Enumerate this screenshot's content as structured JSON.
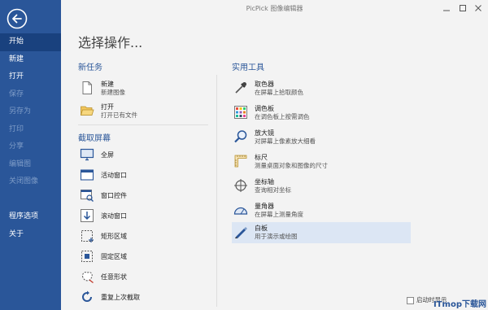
{
  "window": {
    "title": "PicPick 图像编辑器"
  },
  "sidebar": {
    "items": [
      {
        "label": "开始",
        "state": "active"
      },
      {
        "label": "新建",
        "state": "enabled"
      },
      {
        "label": "打开",
        "state": "enabled"
      },
      {
        "label": "保存",
        "state": "disabled"
      },
      {
        "label": "另存为",
        "state": "disabled"
      },
      {
        "label": "打印",
        "state": "disabled"
      },
      {
        "label": "分享",
        "state": "disabled"
      },
      {
        "label": "编辑图",
        "state": "disabled"
      },
      {
        "label": "关闭图像",
        "state": "disabled"
      },
      {
        "label": "",
        "state": "spacer"
      },
      {
        "label": "程序选项",
        "state": "enabled"
      },
      {
        "label": "关于",
        "state": "enabled"
      }
    ]
  },
  "main": {
    "title": "选择操作...",
    "new_task": {
      "header": "新任务",
      "items": [
        {
          "label": "新建",
          "desc": "新建图像",
          "icon": "new-document-icon"
        },
        {
          "label": "打开",
          "desc": "打开已有文件",
          "icon": "open-folder-icon"
        }
      ]
    },
    "capture": {
      "header": "截取屏幕",
      "items": [
        {
          "label": "全屏",
          "icon": "monitor-icon"
        },
        {
          "label": "活动窗口",
          "icon": "active-window-icon"
        },
        {
          "label": "窗口控件",
          "icon": "window-control-icon"
        },
        {
          "label": "滚动窗口",
          "icon": "scrolling-window-icon"
        },
        {
          "label": "矩形区域",
          "icon": "rectangle-region-icon"
        },
        {
          "label": "固定区域",
          "icon": "fixed-region-icon"
        },
        {
          "label": "任意形状",
          "icon": "freehand-shape-icon"
        },
        {
          "label": "重复上次截取",
          "icon": "repeat-capture-icon"
        }
      ]
    },
    "tools": {
      "header": "实用工具",
      "items": [
        {
          "label": "取色器",
          "desc": "在屏幕上拾取颜色",
          "icon": "eyedropper-icon"
        },
        {
          "label": "调色板",
          "desc": "在调色板上按需调色",
          "icon": "color-palette-icon"
        },
        {
          "label": "放大镜",
          "desc": "对屏幕上像素放大细看",
          "icon": "magnifier-icon"
        },
        {
          "label": "标尺",
          "desc": "测量桌面对象和图像的尺寸",
          "icon": "ruler-icon"
        },
        {
          "label": "坐标轴",
          "desc": "查询相对坐标",
          "icon": "crosshair-icon"
        },
        {
          "label": "量角器",
          "desc": "在屏幕上测量角度",
          "icon": "protractor-icon"
        },
        {
          "label": "白板",
          "desc": "用于演示或绘图",
          "icon": "whiteboard-pen-icon",
          "selected": true
        }
      ]
    },
    "startup_label": "启动时显示",
    "watermark": "ITmop下载网"
  },
  "colors": {
    "sidebar_bg": "#2a5699",
    "sidebar_active": "#19417e",
    "accent": "#2a5699",
    "selected_bg": "#dce6f4"
  }
}
